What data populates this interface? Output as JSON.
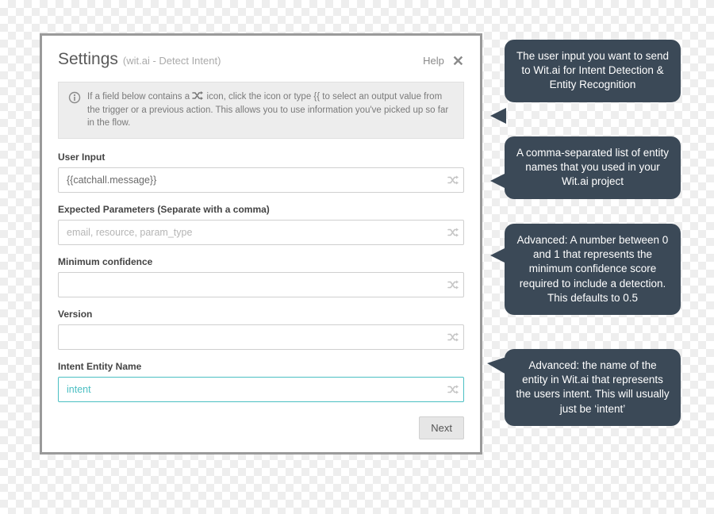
{
  "header": {
    "title": "Settings",
    "subtitle": "(wit.ai - Detect Intent)",
    "help": "Help"
  },
  "info_banner": {
    "text_before": "If a field below contains a ",
    "text_after": " icon, click the icon or type {{ to select an output value from the trigger or a previous action. This allows you to use information you've picked up so far in the flow."
  },
  "fields": {
    "user_input": {
      "label": "User Input",
      "value": "{{catchall.message}}"
    },
    "expected_params": {
      "label": "Expected Parameters (Separate with a comma)",
      "placeholder": "email, resource, param_type"
    },
    "min_confidence": {
      "label": "Minimum confidence",
      "value": ""
    },
    "version": {
      "label": "Version",
      "value": ""
    },
    "intent_entity": {
      "label": "Intent Entity Name",
      "value": "intent"
    }
  },
  "footer": {
    "next": "Next"
  },
  "callouts": {
    "c1": "The user input you want to send to Wit.ai for Intent Detection & Entity Recognition",
    "c2": "A comma-separated list of entity names that you used in your Wit.ai project",
    "c3": "Advanced: A number between 0 and 1 that represents the minimum confidence score required to include a detection. This defaults to 0.5",
    "c4": "Advanced: the name of the entity in Wit.ai that represents the users intent. This will usually just be ‘intent’"
  }
}
